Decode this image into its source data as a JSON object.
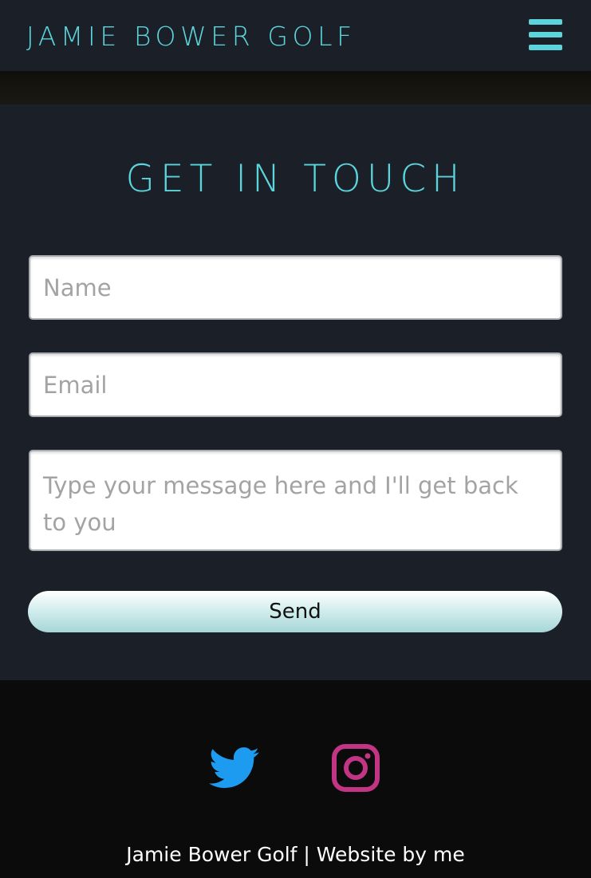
{
  "header": {
    "brand": "JAMIE BOWER GOLF",
    "menu_icon": "hamburger-menu-icon"
  },
  "contact": {
    "title": "GET IN TOUCH",
    "name_placeholder": "Name",
    "email_placeholder": "Email",
    "message_placeholder": "Type your message here and I'll get back to you",
    "send_label": "Send"
  },
  "footer": {
    "social": [
      {
        "icon": "twitter-icon",
        "color": "#1d9bf0"
      },
      {
        "icon": "instagram-icon",
        "color": "#c13584"
      }
    ],
    "credit": "Jamie Bower Golf | Website by me"
  },
  "colors": {
    "accent": "#5bd4dc",
    "background": "#1b1f28",
    "footer_background": "#0b0b0b"
  }
}
